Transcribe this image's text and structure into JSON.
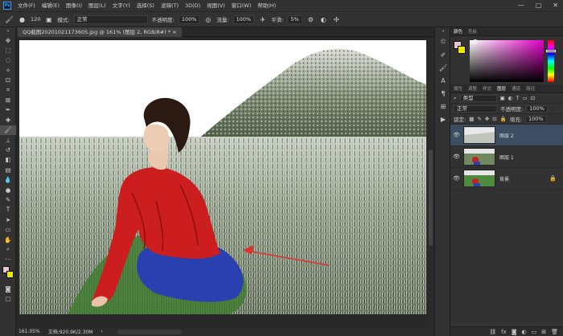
{
  "menu": {
    "items": [
      "文件(F)",
      "编辑(E)",
      "图像(I)",
      "图层(L)",
      "文字(Y)",
      "选择(S)",
      "滤镜(T)",
      "3D(D)",
      "视图(V)",
      "窗口(W)",
      "帮助(H)"
    ],
    "window_controls": [
      "—",
      "▢",
      "✕"
    ]
  },
  "options_bar": {
    "brush_size": "120",
    "mode_label": "模式:",
    "mode_value": "正常",
    "opacity_label": "不透明度:",
    "opacity_value": "100%",
    "flow_label": "流量:",
    "flow_value": "100%",
    "smoothing_label": "平滑:",
    "smoothing_value": "5%"
  },
  "document": {
    "tab_title": "QQ截图20201021173605.jpg @ 161% (图层 2, RGB/8#) * ×",
    "zoom": "161.05%",
    "doc_size": "文档:920.9K/2.30M"
  },
  "panels": {
    "color_tabs": [
      "颜色",
      "色板"
    ],
    "layer_tabs": [
      "属性",
      "调整",
      "样式",
      "图层",
      "通道",
      "路径"
    ],
    "kind_filter": "类型",
    "blend_mode": "正常",
    "opacity_label": "不透明度:",
    "opacity_value": "100%",
    "lock_label": "锁定:",
    "fill_label": "填充:",
    "fill_value": "100%",
    "layers": [
      {
        "name": "图层 2",
        "selected": true
      },
      {
        "name": "图层 1",
        "selected": false
      },
      {
        "name": "背景",
        "selected": false
      }
    ]
  },
  "colors": {
    "foreground": "#e4c4d0",
    "background": "#ece600",
    "accent": "#31a8ff",
    "selected_layer": "#3d4e63"
  }
}
